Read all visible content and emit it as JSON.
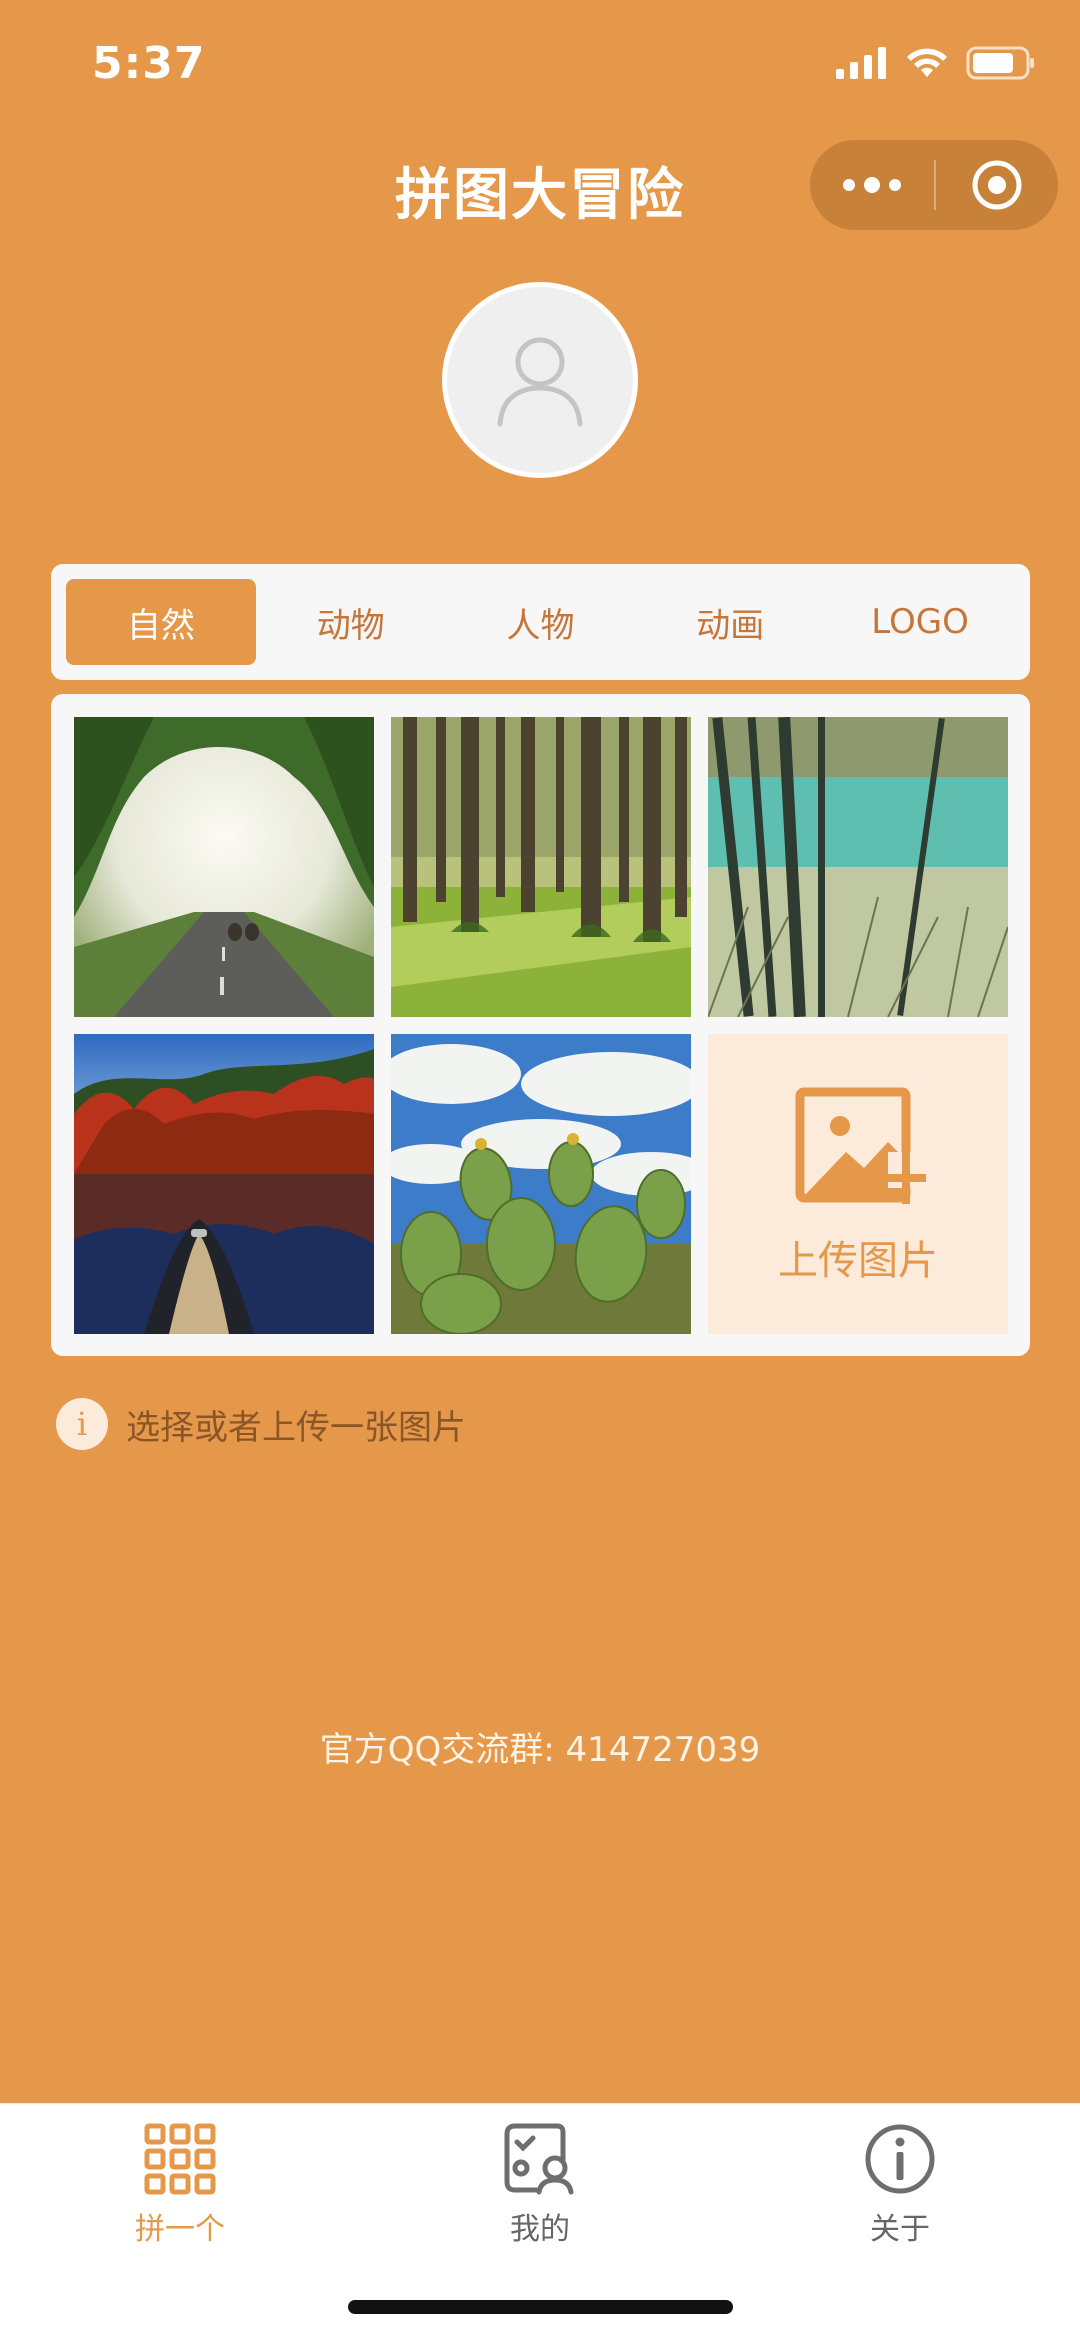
{
  "status_bar": {
    "time": "5:37"
  },
  "title": "拼图大冒险",
  "tabs": [
    {
      "label": "自然",
      "active": true
    },
    {
      "label": "动物",
      "active": false
    },
    {
      "label": "人物",
      "active": false
    },
    {
      "label": "动画",
      "active": false
    },
    {
      "label": "LOGO",
      "active": false
    }
  ],
  "gallery": {
    "images": [
      "road-with-sheep-photo",
      "forest-trees-photo",
      "bamboo-lake-photo",
      "autumn-lake-canoe-photo",
      "cactus-sky-photo"
    ],
    "upload_label": "上传图片"
  },
  "hint": {
    "text": "选择或者上传一张图片",
    "icon": "i"
  },
  "qq_group": "官方QQ交流群: 414727039",
  "bottom_nav": [
    {
      "label": "拼一个",
      "icon": "grid-icon",
      "active": true
    },
    {
      "label": "我的",
      "icon": "profile-card-icon",
      "active": false
    },
    {
      "label": "关于",
      "icon": "info-icon",
      "active": false
    }
  ],
  "colors": {
    "primary": "#E5984A",
    "panel": "#F7F7F7",
    "upload_bg": "#FCEBDA"
  }
}
